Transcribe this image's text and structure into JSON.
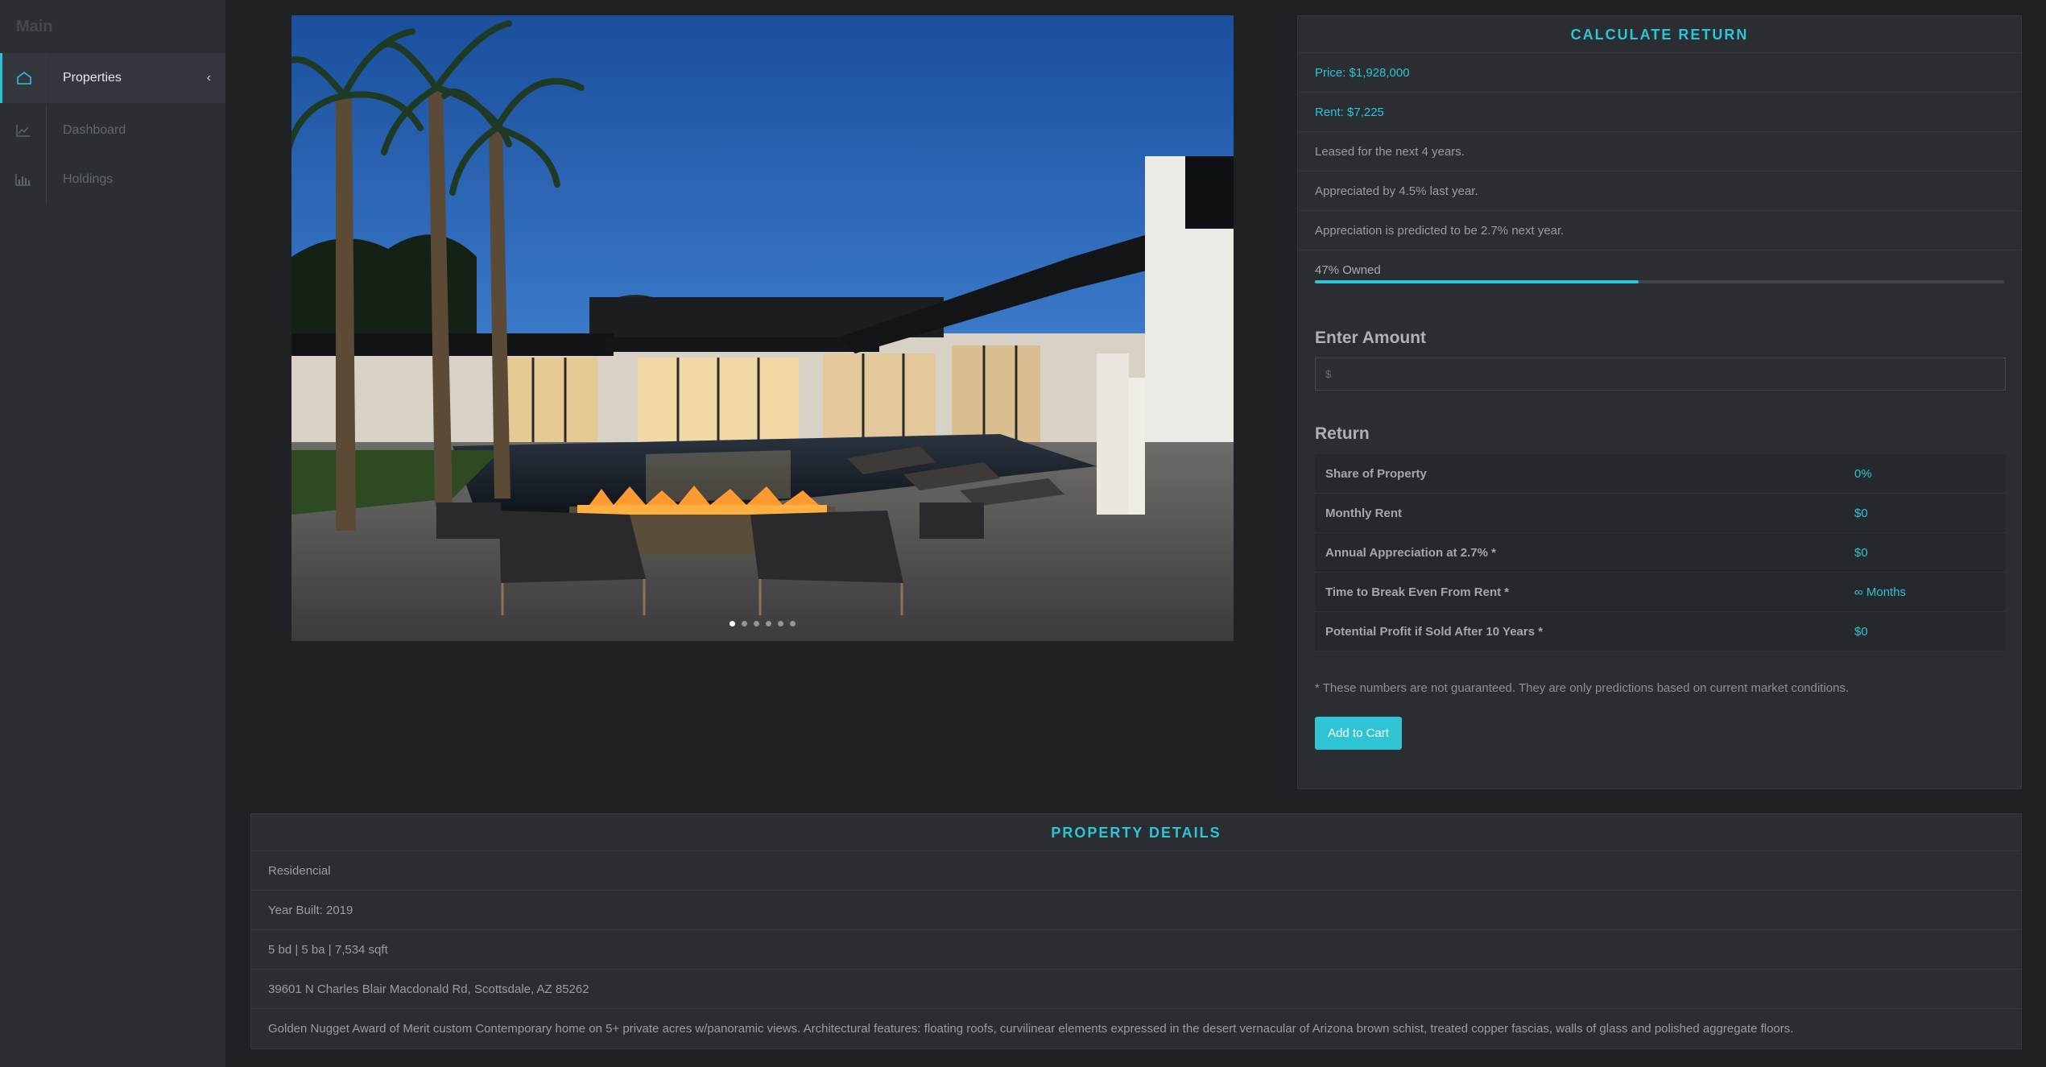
{
  "sidebar": {
    "heading": "Main",
    "items": [
      {
        "label": "Properties",
        "icon": "home-icon",
        "active": true
      },
      {
        "label": "Dashboard",
        "icon": "line-chart-icon",
        "active": false
      },
      {
        "label": "Holdings",
        "icon": "bar-chart-icon",
        "active": false
      }
    ]
  },
  "carousel": {
    "slide_count": 6,
    "active_slide": 1
  },
  "calculate": {
    "title": "CALCULATE RETURN",
    "price": "Price: $1,928,000",
    "rent": "Rent: $7,225",
    "leased": "Leased for the next 4 years.",
    "appreciated": "Appreciated by 4.5% last year.",
    "predicted": "Appreciation is predicted to be 2.7% next year.",
    "owned_label": "47% Owned",
    "owned_fraction": 0.47,
    "enter_amount_heading": "Enter Amount",
    "amount_placeholder": "$",
    "return_heading": "Return",
    "returns": [
      {
        "label": "Share of Property",
        "value": "0%"
      },
      {
        "label": "Monthly Rent",
        "value": "$0"
      },
      {
        "label": "Annual Appreciation at 2.7% *",
        "value": "$0"
      },
      {
        "label": "Time to Break Even From Rent *",
        "value": "∞ Months"
      },
      {
        "label": "Potential Profit if Sold After 10 Years *",
        "value": "$0"
      }
    ],
    "disclaimer": "* These numbers are not guaranteed. They are only predictions based on current market conditions.",
    "add_to_cart": "Add to Cart"
  },
  "details": {
    "title": "PROPERTY DETAILS",
    "type": "Residencial",
    "year_built": "Year Built: 2019",
    "specs": "5 bd | 5 ba | 7,534 sqft",
    "address": "39601 N Charles Blair Macdonald Rd, Scottsdale, AZ 85262",
    "description": "Golden Nugget Award of Merit custom Contemporary home on 5+ private acres w/panoramic views. Architectural features: floating roofs, curvilinear elements expressed in the desert vernacular of Arizona brown schist, treated copper fascias, walls of glass and polished aggregate floors."
  },
  "colors": {
    "accent": "#2ec4d6",
    "background": "#1f2125",
    "panel": "#2a2d32"
  }
}
